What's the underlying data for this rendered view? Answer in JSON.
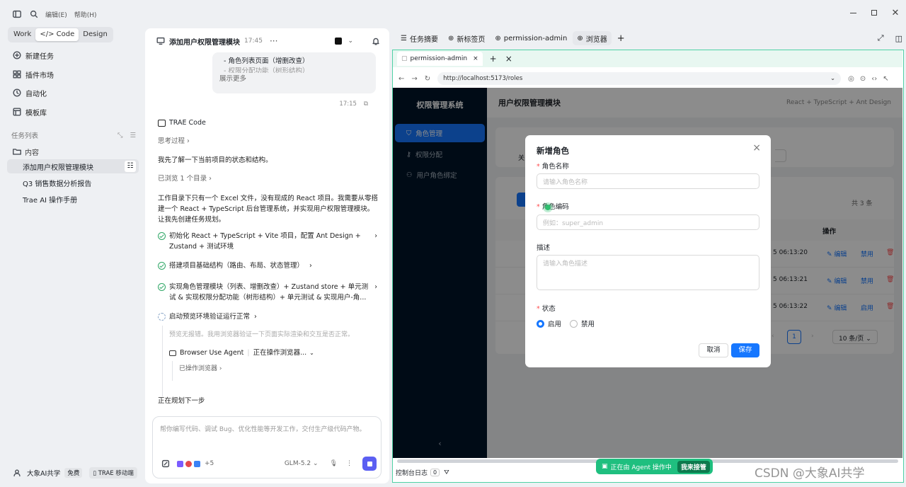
{
  "topbar": {
    "menu_edit": "编辑(E)",
    "menu_help": "帮助(H)"
  },
  "sidebar": {
    "modes": [
      "Work",
      "Code",
      "Design"
    ],
    "nav": [
      {
        "label": "新建任务",
        "icon": "compose-icon"
      },
      {
        "label": "插件市场",
        "icon": "plugin-icon"
      },
      {
        "label": "自动化",
        "icon": "clock-icon"
      },
      {
        "label": "模板库",
        "icon": "template-icon"
      }
    ],
    "task_list_title": "任务列表",
    "folder": "内容",
    "tasks": [
      "添加用户权限管理模块",
      "Q3 销售数据分析报告",
      "Trae AI 操作手册"
    ],
    "user": "大象AI共学",
    "user_plan": "免费",
    "mobile_btn": "TRAE 移动端"
  },
  "chat": {
    "title": "添加用户权限管理模块",
    "time": "17:45",
    "quote_line1": "- 角色列表页面（增删改查）",
    "quote_line2": "- 权限分配功能（树形结构）",
    "show_more": "展示更多",
    "msg_time": "17:15",
    "agent_name": "TRAE Code",
    "thinking": "思考过程",
    "intro": "我先了解一下当前项目的状态和结构。",
    "browsed": "已浏览 1 个目录",
    "analysis": "工作目录下只有一个 Excel 文件，没有现成的 React 项目。我需要从零搭建一个 React + TypeScript 后台管理系统，并实现用户权限管理模块。让我先创建任务规划。",
    "steps": [
      "初始化 React + TypeScript + Vite 项目，配置 Ant Design + Zustand + 测试环境",
      "搭建项目基础结构（路由、布局、状态管理）",
      "实现角色管理模块（列表、增删改查）+ Zustand store + 单元测试 & 实现权限分配功能（树形结构）+ 单元测试 & 实现用户-角..."
    ],
    "running_step": "启动预览环境验证运行正常",
    "preview_note": "预览无报错。我用浏览器验证一下页面实际渲染和交互是否正常。",
    "agent_tool": "Browser Use Agent",
    "agent_status": "正在操作浏览器...",
    "sub_action": "已操作浏览器",
    "planning": "正在规划下一步",
    "input_placeholder": "帮你编写代码、调试 Bug、优化性能等开发工作，交付生产级代码产物。",
    "plus_count": "+5",
    "model": "GLM-5.2"
  },
  "right": {
    "tabs": [
      "任务摘要",
      "新标签页",
      "permission-admin",
      "浏览器"
    ],
    "browser_tab": "permission-admin",
    "url": "http://localhost:5173/roles",
    "console": "控制台日志",
    "console_count": "0",
    "agent_banner": "正在由 Agent 操作中",
    "takeover": "我来接管",
    "watermark": "CSDN @大象AI共学"
  },
  "app": {
    "logo": "权限管理系统",
    "menu": [
      "角色管理",
      "权限分配",
      "用户角色绑定"
    ],
    "header": "用户权限管理模块",
    "stack": "React + TypeScript + Ant Design",
    "filter_label": "关",
    "total": "共 3 条",
    "col_action": "操作",
    "rows": [
      {
        "time": "5 06:13:20",
        "status": "禁用"
      },
      {
        "time": "5 06:13:21",
        "status": "禁用"
      },
      {
        "time": "5 06:13:22",
        "status": "启用"
      }
    ],
    "edit": "编辑",
    "page": "1",
    "page_size": "10 条/页"
  },
  "modal": {
    "title": "新增角色",
    "name_label": "角色名称",
    "name_ph": "请输入角色名称",
    "code_label": "角色编码",
    "code_ph": "例如：super_admin",
    "desc_label": "描述",
    "desc_ph": "请输入角色描述",
    "status_label": "状态",
    "opt_on": "启用",
    "opt_off": "禁用",
    "cancel": "取消",
    "save": "保存"
  },
  "colors": {
    "accent": "#1677ff",
    "brand_green": "#1fbf7f",
    "app_sidebar": "#001529"
  }
}
